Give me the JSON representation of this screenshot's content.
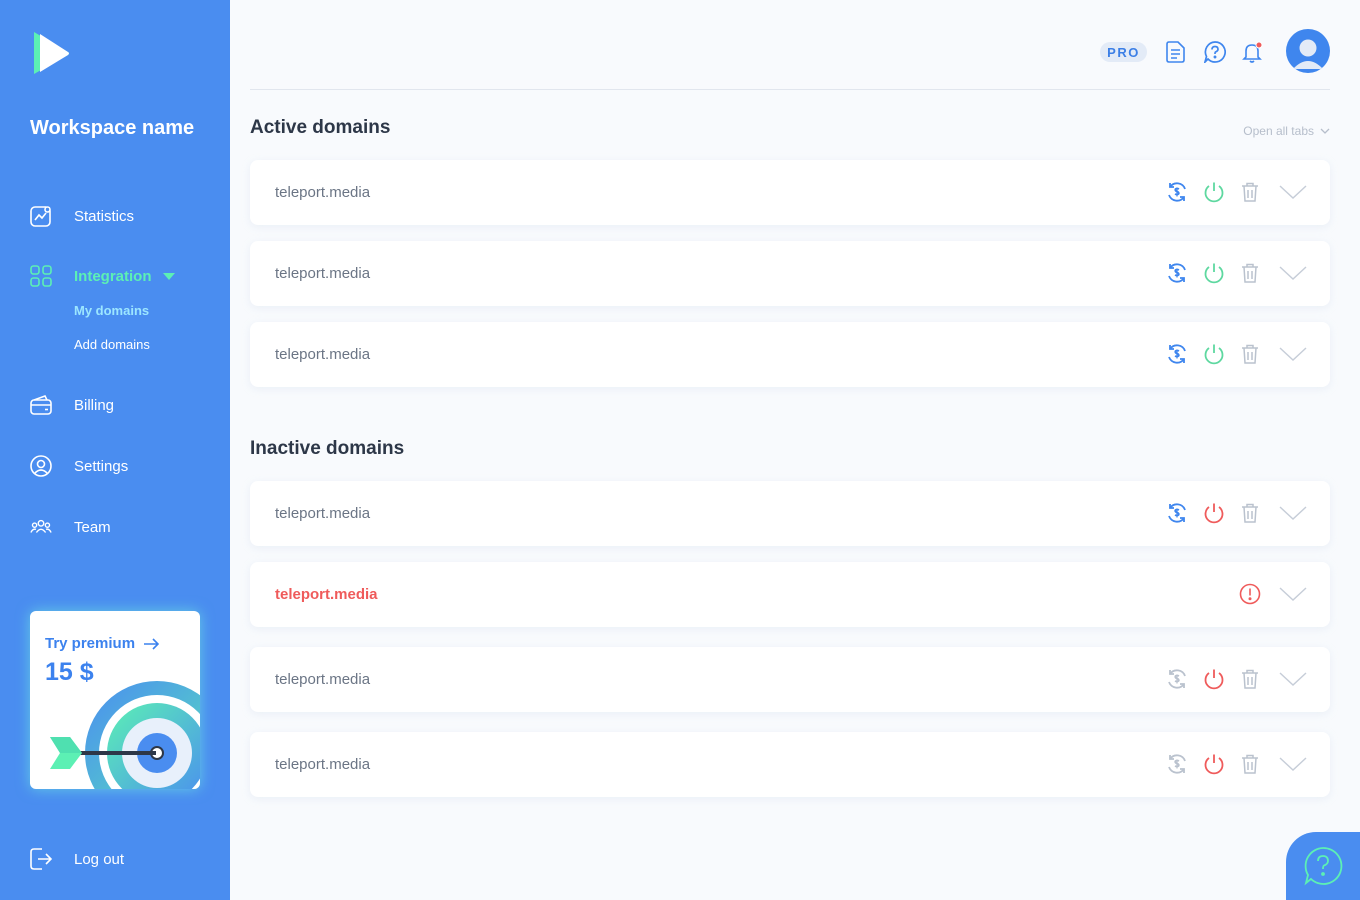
{
  "sidebar": {
    "workspace_name": "Workspace name",
    "nav": {
      "statistics": "Statistics",
      "integration": "Integration",
      "billing": "Billing",
      "settings": "Settings",
      "team": "Team",
      "logout": "Log out"
    },
    "integration_sub": {
      "my_domains": "My domains",
      "add_domains": "Add domains"
    },
    "premium": {
      "title": "Try premium",
      "price": "15 $"
    }
  },
  "header": {
    "plan_badge": "PRO",
    "icons": [
      "document-icon",
      "help-icon",
      "notification-bell-icon",
      "avatar"
    ]
  },
  "active_section": {
    "title": "Active domains",
    "open_all_label": "Open all tabs",
    "rows": [
      {
        "domain": "teleport.media",
        "status": "active"
      },
      {
        "domain": "teleport.media",
        "status": "active"
      },
      {
        "domain": "teleport.media",
        "status": "active"
      }
    ]
  },
  "inactive_section": {
    "title": "Inactive domains",
    "rows": [
      {
        "domain": "teleport.media",
        "status": "inactive"
      },
      {
        "domain": "teleport.media",
        "status": "error"
      },
      {
        "domain": "teleport.media",
        "status": "inactive-disabled"
      },
      {
        "domain": "teleport.media",
        "status": "inactive-disabled"
      }
    ]
  },
  "colors": {
    "sidebar": "#4A8DF0",
    "accent_green": "#5CF0B4",
    "power_active": "#5ED8A0",
    "power_inactive": "#EF5B5B",
    "error": "#EF5B5B",
    "monetize": "#3F86EE",
    "muted_icon": "#BAC2CE"
  }
}
